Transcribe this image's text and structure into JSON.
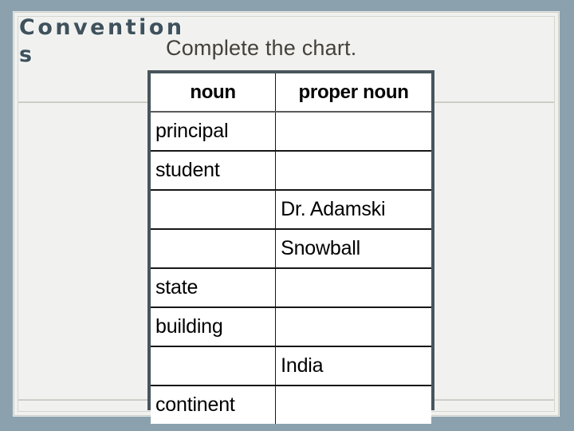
{
  "slide": {
    "title": "Conventions",
    "subtitle": "Complete the chart.",
    "background_color": "#8ba2ae",
    "panel_color": "#f1f1ef",
    "title_color": "#3f525c",
    "subtitle_color": "#45413b",
    "table_border_color": "#48555c"
  },
  "chart_data": {
    "type": "table",
    "title": "Complete the chart.",
    "columns": [
      "noun",
      "proper noun"
    ],
    "rows": [
      {
        "noun": "principal",
        "proper_noun": ""
      },
      {
        "noun": "student",
        "proper_noun": ""
      },
      {
        "noun": "",
        "proper_noun": "Dr. Adamski"
      },
      {
        "noun": "",
        "proper_noun": "Snowball"
      },
      {
        "noun": "state",
        "proper_noun": ""
      },
      {
        "noun": "building",
        "proper_noun": ""
      },
      {
        "noun": "",
        "proper_noun": "India"
      },
      {
        "noun": "continent",
        "proper_noun": ""
      }
    ]
  }
}
